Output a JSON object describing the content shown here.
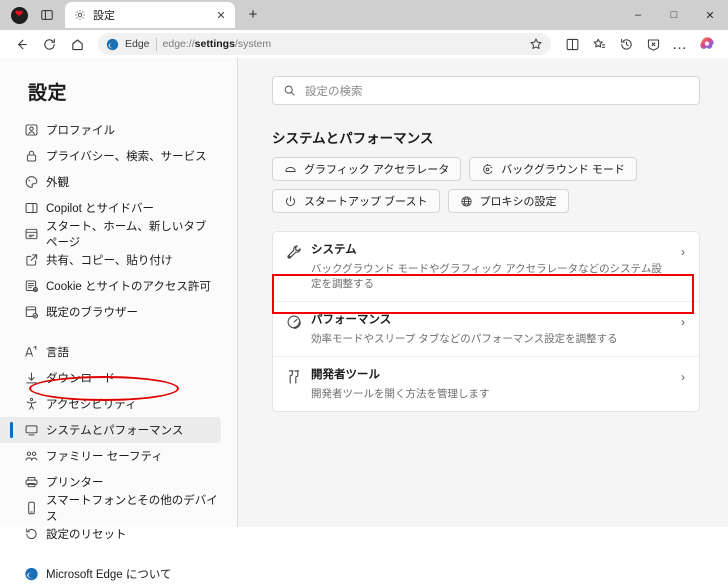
{
  "window": {
    "minimize_label": "–",
    "maximize_label": "□",
    "close_label": "✕"
  },
  "tabstrip": {
    "profile_icon": "heart-avatar-icon",
    "tab_search_icon": "tab-list-icon",
    "tab": {
      "icon": "gear-icon",
      "title": "設定",
      "close_label": "✕"
    },
    "new_tab_label": "+"
  },
  "toolbar": {
    "back_label": "←",
    "refresh_label": "⟳",
    "home_label": "⌂",
    "omnibox": {
      "brand_label": "Edge",
      "url_prefix": "edge://",
      "url_bold": "settings",
      "url_suffix": "/system",
      "favorite_icon": "star-icon"
    },
    "actions": [
      {
        "name": "split-screen-icon",
        "label": "split-screen"
      },
      {
        "name": "collections-icon",
        "label": "collections"
      },
      {
        "name": "history-icon",
        "label": "history"
      },
      {
        "name": "browser-essentials-icon",
        "label": "browser-essentials"
      },
      {
        "name": "settings-and-more-icon",
        "label": "…"
      },
      {
        "name": "copilot-icon",
        "label": "copilot"
      }
    ]
  },
  "sidebar": {
    "heading": "設定",
    "items": [
      {
        "icon": "profile-icon",
        "label": "プロファイル",
        "selected": false,
        "gap_before": "none"
      },
      {
        "icon": "lock-icon",
        "label": "プライバシー、検索、サービス",
        "selected": false,
        "gap_before": "none"
      },
      {
        "icon": "appearance-icon",
        "label": "外観",
        "selected": false,
        "gap_before": "none"
      },
      {
        "icon": "sidebar-icon",
        "label": "Copilot とサイドバー",
        "selected": false,
        "gap_before": "none"
      },
      {
        "icon": "newtab-icon",
        "label": "スタート、ホーム、新しいタブ ページ",
        "selected": false,
        "gap_before": "none"
      },
      {
        "icon": "share-icon",
        "label": "共有、コピー、貼り付け",
        "selected": false,
        "gap_before": "none"
      },
      {
        "icon": "cookies-icon",
        "label": "Cookie とサイトのアクセス許可",
        "selected": false,
        "gap_before": "none"
      },
      {
        "icon": "default-browser-icon",
        "label": "既定のブラウザー",
        "selected": false,
        "gap_before": "none"
      },
      {
        "icon": "language-icon",
        "label": "言語",
        "selected": false,
        "gap_before": "large"
      },
      {
        "icon": "download-icon",
        "label": "ダウンロード",
        "selected": false,
        "gap_before": "none"
      },
      {
        "icon": "accessibility-icon",
        "label": "アクセシビリティ",
        "selected": false,
        "gap_before": "none"
      },
      {
        "icon": "system-icon",
        "label": "システムとパフォーマンス",
        "selected": true,
        "gap_before": "none"
      },
      {
        "icon": "family-icon",
        "label": "ファミリー セーフティ",
        "selected": false,
        "gap_before": "none"
      },
      {
        "icon": "printer-icon",
        "label": "プリンター",
        "selected": false,
        "gap_before": "none"
      },
      {
        "icon": "phone-icon",
        "label": "スマートフォンとその他のデバイス",
        "selected": false,
        "gap_before": "none"
      },
      {
        "icon": "reset-icon",
        "label": "設定のリセット",
        "selected": false,
        "gap_before": "none"
      },
      {
        "icon": "edge-icon",
        "label": "Microsoft Edge について",
        "selected": false,
        "gap_before": "large"
      }
    ]
  },
  "content": {
    "search": {
      "icon": "search-icon",
      "placeholder": "設定の検索",
      "value": ""
    },
    "section_title": "システムとパフォーマンス",
    "chips": [
      {
        "icon": "graphics-accelerator-icon",
        "label": "グラフィック アクセラレータ"
      },
      {
        "icon": "background-mode-icon",
        "label": "バックグラウンド モード"
      },
      {
        "icon": "startup-boost-icon",
        "label": "スタートアップ ブースト"
      },
      {
        "icon": "proxy-icon",
        "label": "プロキシの設定"
      }
    ],
    "rows": [
      {
        "icon": "wrench-icon",
        "title": "システム",
        "desc": "バックグラウンド モードやグラフィック アクセラレータなどのシステム設定を調整する",
        "chevron": "›",
        "highlighted": false
      },
      {
        "icon": "performance-icon",
        "title": "パフォーマンス",
        "desc": "効率モードやスリープ タブなどのパフォーマンス設定を調整する",
        "chevron": "›",
        "highlighted": true
      },
      {
        "icon": "devtools-icon",
        "title": "開発者ツール",
        "desc": "開発者ツールを開く方法を管理します",
        "chevron": "›",
        "highlighted": false
      }
    ]
  },
  "annotations": {
    "sidebar_ellipse": {
      "shape": "ellipse",
      "color": "#e00000",
      "target": "システムとパフォーマンス"
    },
    "row_rectangle": {
      "shape": "rectangle",
      "color": "#f40000",
      "target": "パフォーマンス"
    }
  },
  "colors": {
    "titlebar_bg": "#cfcfcf",
    "page_bg": "#f5f5f5",
    "sidebar_bg": "#fbfbfb",
    "card_bg": "#ffffff",
    "selection_accent": "#0f6cbd",
    "annotation_red": "#e00000"
  }
}
